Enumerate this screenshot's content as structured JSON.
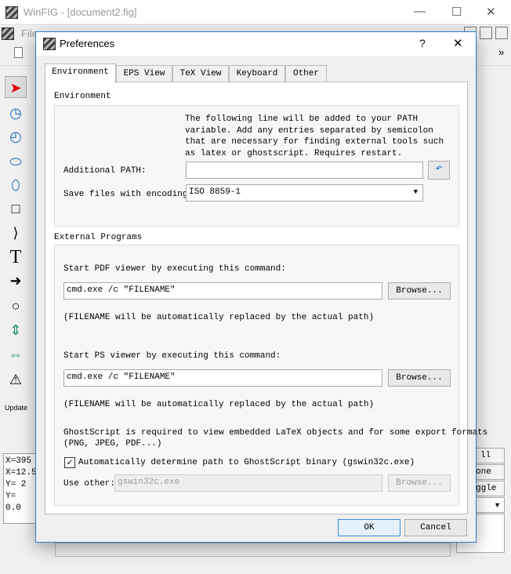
{
  "main_window": {
    "title": "WinFIG - [document2.fig]",
    "menu_first": "File",
    "toolbar_overflow": "»",
    "readout": [
      "X=395",
      "X=12.5",
      "Y=  2",
      "Y= 0.0"
    ],
    "side_buttons": [
      "ll",
      "one",
      "ggle"
    ],
    "update_label": "Update"
  },
  "dialog": {
    "title": "Preferences",
    "help": "?",
    "close": "✕",
    "tabs": [
      {
        "label": "Environment",
        "active": true
      },
      {
        "label": "EPS View"
      },
      {
        "label": "TeX View"
      },
      {
        "label": "Keyboard"
      },
      {
        "label": "Other"
      }
    ],
    "environment": {
      "heading": "Environment",
      "info": [
        "The following line will be added to your PATH",
        "variable. Add any entries separated by semicolon",
        "that are necessary for finding external tools such",
        "as latex or ghostscript. Requires restart."
      ],
      "path_label": "Additional PATH:",
      "path_value": "",
      "encoding_label": "Save files with encoding:",
      "encoding_value": "ISO 8859-1"
    },
    "external": {
      "heading": "External Programs",
      "pdf_label": "Start PDF viewer by executing this command:",
      "pdf_value": "cmd.exe /c \"FILENAME\"",
      "browse": "Browse...",
      "note": "(FILENAME will be automatically replaced by the actual path)",
      "ps_label": "Start PS viewer by executing this command:",
      "ps_value": "cmd.exe /c \"FILENAME\"",
      "gs_info": [
        "GhostScript is required to view embedded LaTeX objects and for some export formats",
        "(PNG, JPEG, PDF...)"
      ],
      "auto_label": "Automatically determine path to GhostScript binary (gswin32c.exe)",
      "auto_checked": true,
      "other_label": "Use other:",
      "other_value": "gswin32c.exe"
    },
    "ok": "OK",
    "cancel": "Cancel"
  },
  "colors": {
    "accent": "#2b7bd4",
    "tool_icon": "#1565c0"
  }
}
